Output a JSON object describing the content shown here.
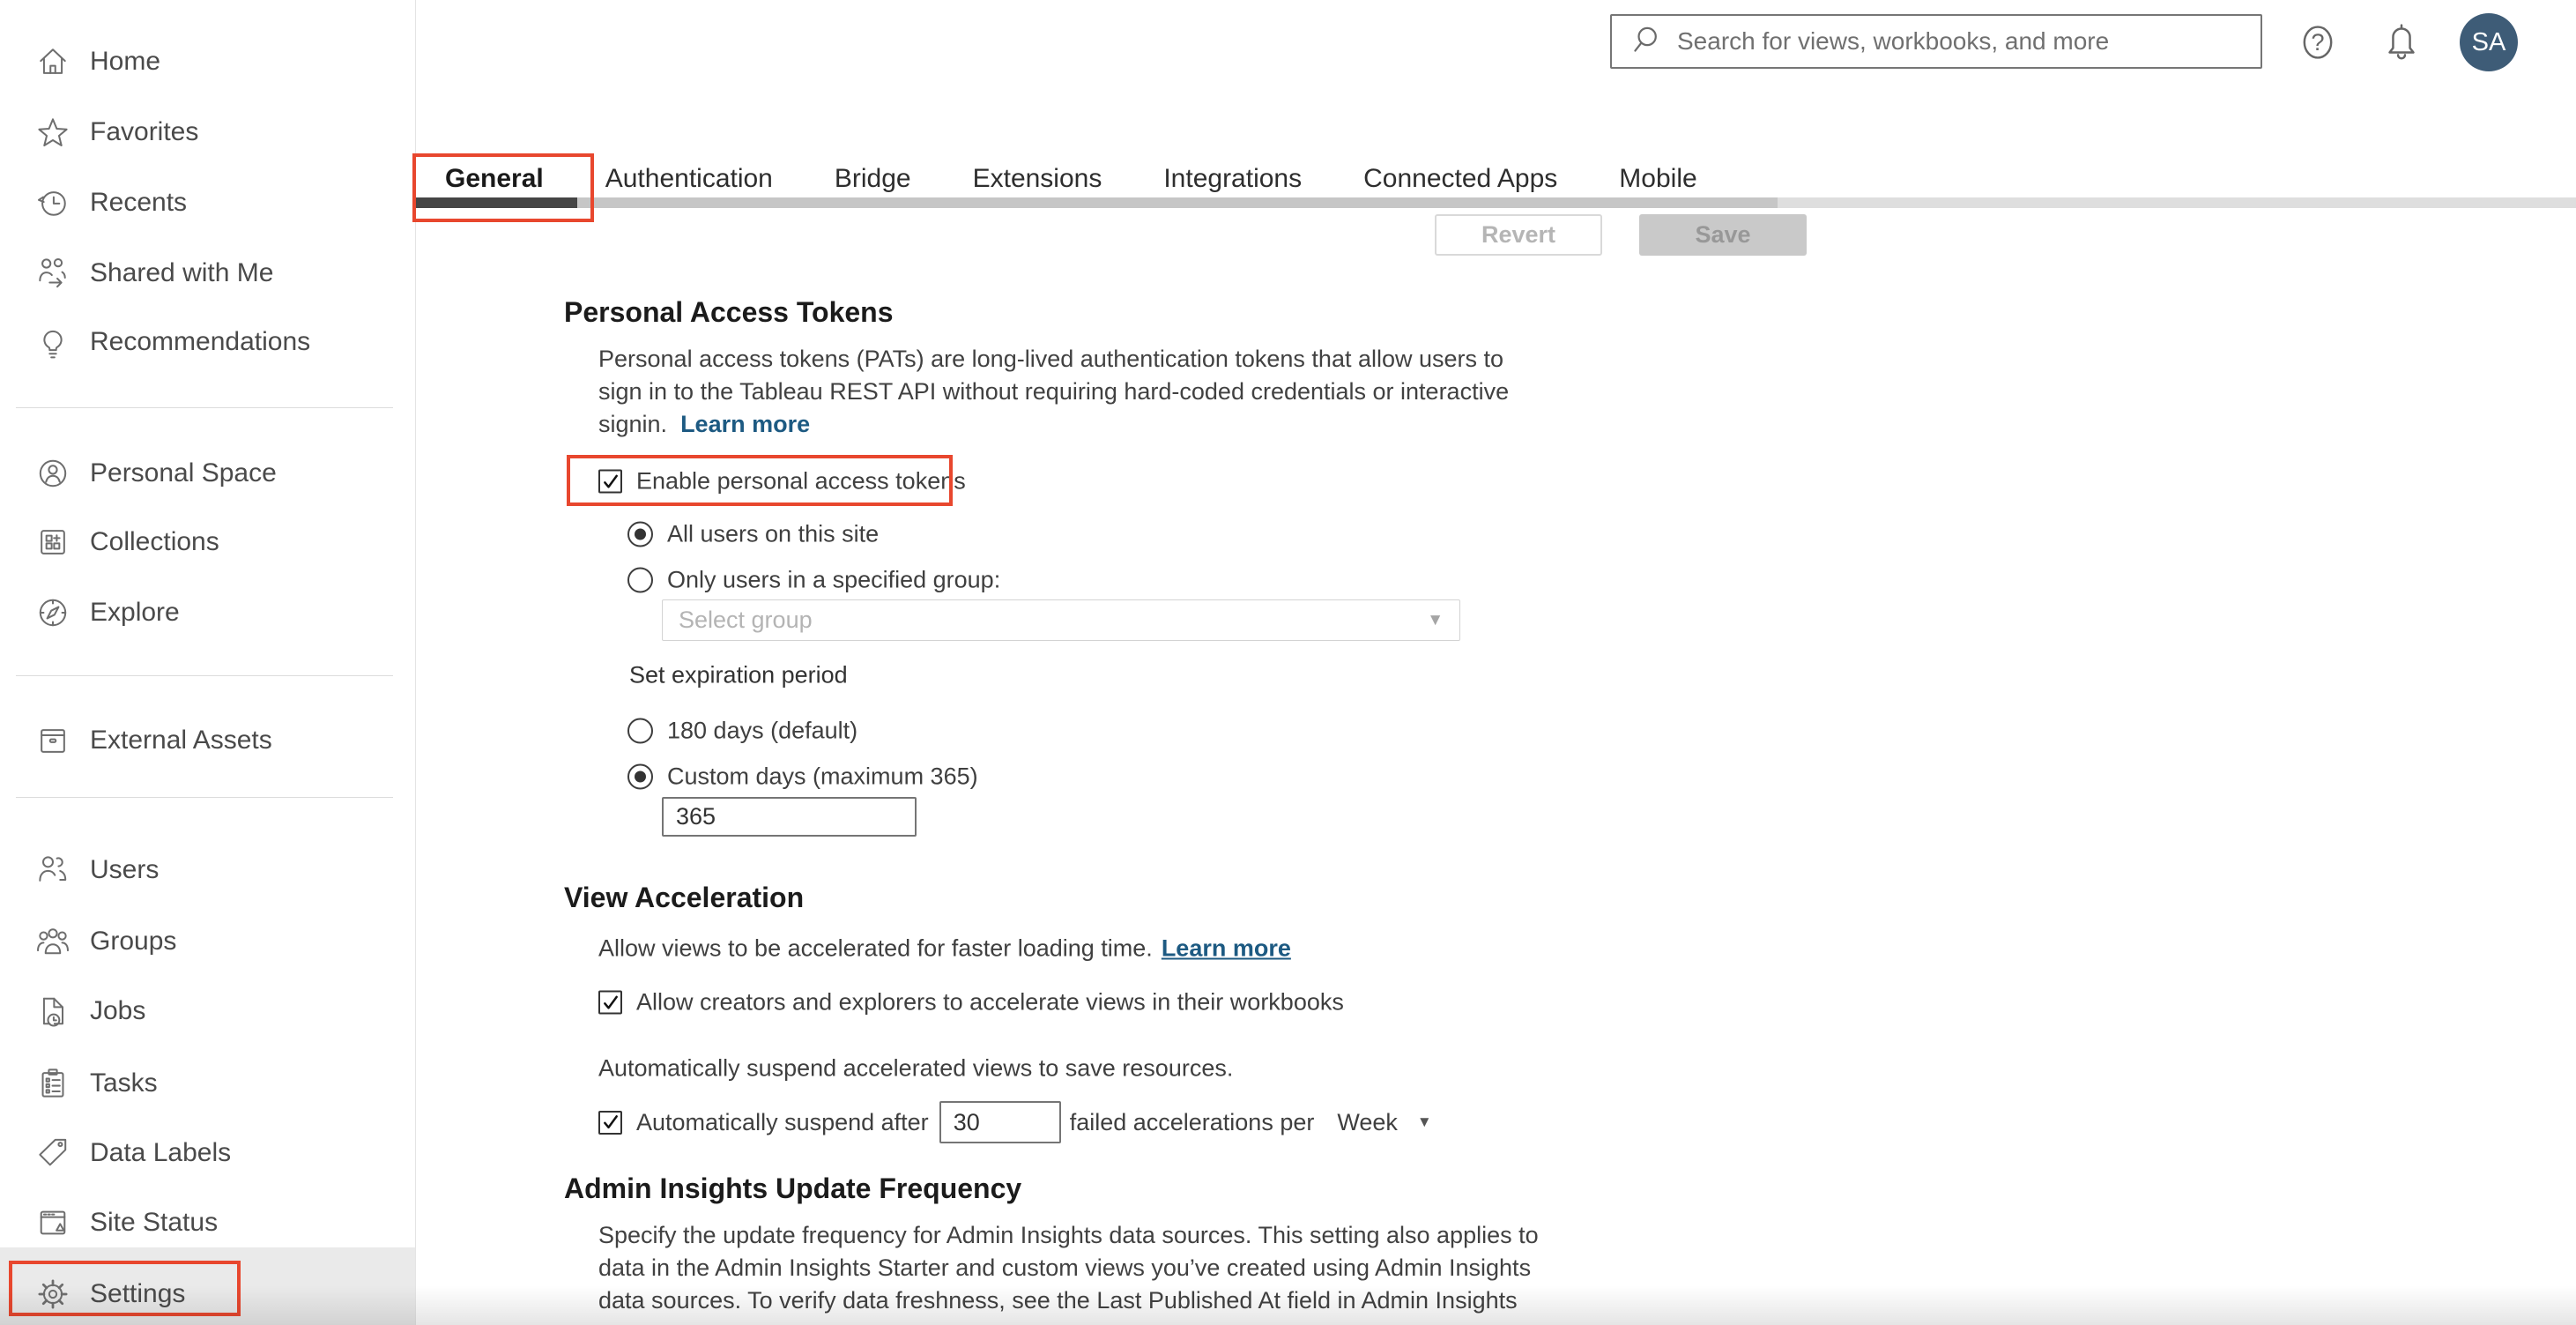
{
  "header": {
    "search_placeholder": "Search for views, workbooks, and more",
    "avatar_initials": "SA",
    "avatar_color": "#3e5c77"
  },
  "sidebar": {
    "items": [
      {
        "label": "Home",
        "icon": "home-icon"
      },
      {
        "label": "Favorites",
        "icon": "star-icon"
      },
      {
        "label": "Recents",
        "icon": "recents-icon"
      },
      {
        "label": "Shared with Me",
        "icon": "shared-with-me-icon"
      },
      {
        "label": "Recommendations",
        "icon": "lightbulb-icon"
      },
      {
        "label": "Personal Space",
        "icon": "person-circle-icon"
      },
      {
        "label": "Collections",
        "icon": "collections-icon"
      },
      {
        "label": "Explore",
        "icon": "compass-icon"
      },
      {
        "label": "External Assets",
        "icon": "archive-box-icon"
      },
      {
        "label": "Users",
        "icon": "users-icon"
      },
      {
        "label": "Groups",
        "icon": "groups-icon"
      },
      {
        "label": "Jobs",
        "icon": "document-clock-icon"
      },
      {
        "label": "Tasks",
        "icon": "clipboard-icon"
      },
      {
        "label": "Data Labels",
        "icon": "tag-icon"
      },
      {
        "label": "Site Status",
        "icon": "site-status-icon"
      },
      {
        "label": "Settings",
        "icon": "gear-icon"
      }
    ],
    "selected": "Settings"
  },
  "tabs": {
    "items": [
      "General",
      "Authentication",
      "Bridge",
      "Extensions",
      "Integrations",
      "Connected Apps",
      "Mobile"
    ],
    "active": "General"
  },
  "toolbar": {
    "revert_label": "Revert",
    "save_label": "Save"
  },
  "sections": {
    "pat": {
      "heading": "Personal Access Tokens",
      "description_lines": [
        "Personal access tokens (PATs) are long-lived authentication tokens that allow users to",
        "sign in to the Tableau REST API without requiring hard-coded credentials or interactive",
        "signin."
      ],
      "learn_more": "Learn more",
      "enable_checkbox": {
        "label": "Enable personal access tokens",
        "checked": true
      },
      "scope_radios": [
        {
          "label": "All users on this site",
          "selected": true
        },
        {
          "label": "Only users in a specified group:",
          "selected": false
        }
      ],
      "group_select_placeholder": "Select group",
      "expiration_label": "Set expiration period",
      "expiration_radios": [
        {
          "label": "180 days (default)",
          "selected": false
        },
        {
          "label": "Custom days (maximum 365)",
          "selected": true
        }
      ],
      "custom_days_value": "365"
    },
    "view_acceleration": {
      "heading": "View Acceleration",
      "description": "Allow views to be accelerated for faster loading time.",
      "learn_more": "Learn more",
      "allow_checkbox": {
        "label": "Allow creators and explorers to accelerate views in their workbooks",
        "checked": true
      },
      "suspend_note": "Automatically suspend accelerated views to save resources.",
      "suspend_checkbox": {
        "label": "Automatically suspend after",
        "checked": true
      },
      "suspend_value": "30",
      "suspend_suffix": "failed accelerations per",
      "suspend_period": "Week"
    },
    "admin_insights": {
      "heading": "Admin Insights Update Frequency",
      "description_lines": [
        "Specify the update frequency for Admin Insights data sources. This setting also applies to",
        "data in the Admin Insights Starter and custom views you’ve created using Admin Insights",
        "data sources. To verify data freshness, see the Last Published At field in Admin Insights"
      ]
    }
  },
  "annotation_color": "#e8472e"
}
